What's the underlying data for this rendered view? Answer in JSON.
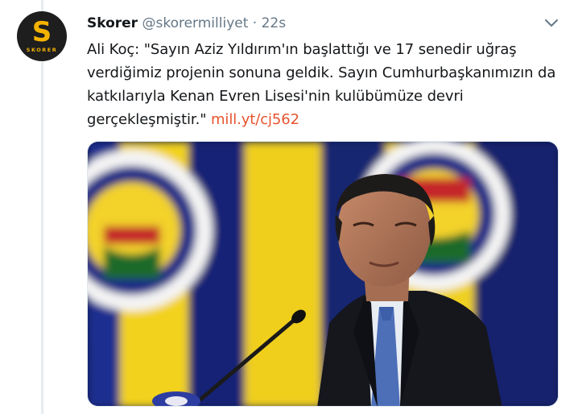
{
  "tweet": {
    "author_name": "Skorer",
    "author_handle": "@skorermilliyet",
    "separator": "·",
    "time": "22s",
    "avatar_letter": "S",
    "avatar_text": "SKORER",
    "text_parts": {
      "body": "Ali Koç: \"Sayın Aziz Yıldırım'ın başlattığı ve 17 senedir uğraş verdiğimiz projenin sonuna geldik. Sayın Cumhurbaşkanımızın da katkılarıyla Kenan Evren Lisesi'nin kulübümüze devri gerçekleşmiştir.\" ",
      "link": "mill.yt/cj562"
    },
    "menu_icon": "chevron-down-icon"
  },
  "colors": {
    "link": "#e8542f",
    "avatar_bg": "#1e1e1e",
    "avatar_accent": "#f5b300",
    "handle": "#657786"
  }
}
